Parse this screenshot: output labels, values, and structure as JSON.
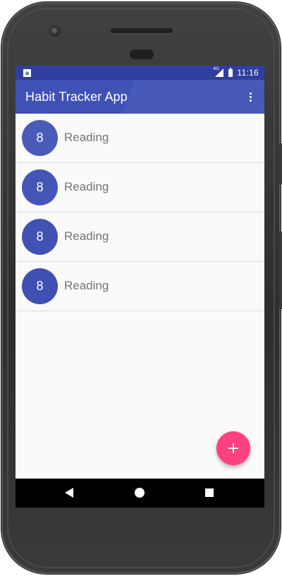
{
  "status_bar": {
    "time": "11:16",
    "network_label": "4G",
    "notification_icon": "a",
    "colors": {
      "background": "#303f9f"
    }
  },
  "app_bar": {
    "title": "Habit Tracker App",
    "overflow_icon": "more-vert-icon",
    "colors": {
      "background": "#3f51b5"
    }
  },
  "habits": [
    {
      "count": "8",
      "name": "Reading"
    },
    {
      "count": "8",
      "name": "Reading"
    },
    {
      "count": "8",
      "name": "Reading"
    },
    {
      "count": "8",
      "name": "Reading"
    }
  ],
  "fab": {
    "label": "+",
    "icon": "add-icon",
    "color": "#ff4081"
  },
  "nav_bar": {
    "back_icon": "back-triangle-icon",
    "home_icon": "home-circle-icon",
    "recents_icon": "recents-square-icon"
  }
}
